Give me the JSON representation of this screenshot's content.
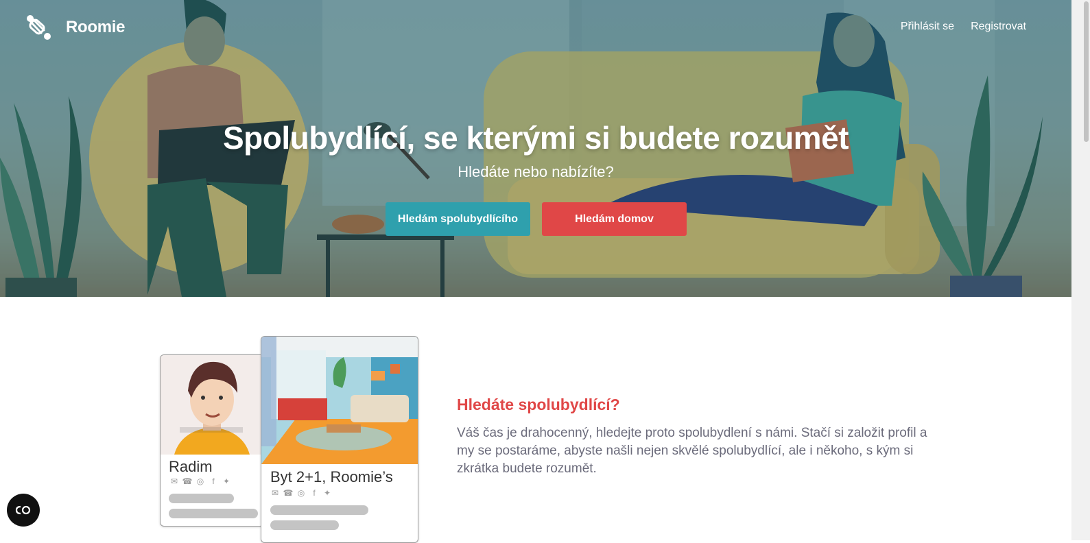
{
  "app": {
    "name": "Roomie"
  },
  "nav": {
    "login": "Přihlásit se",
    "register": "Registrovat"
  },
  "hero": {
    "title": "Spolubydlící, se kterými si budete rozumět",
    "subtitle": "Hledáte nebo nabízíte?",
    "btn_roommate": "Hledám spolubydlícího",
    "btn_home": "Hledám domov"
  },
  "cards": {
    "person_name": "Radim",
    "flat_name": "Byt 2+1, Roomie’s"
  },
  "info": {
    "title": "Hledáte spolubydlící?",
    "text": "Váš čas je drahocenný, hledejte proto spolubydlení s námi. Stačí si založit profil a my se postaráme, abyste našli nejen skvělé spolubydlící, ale i někoho, s kým si zkrátka budete rozumět."
  },
  "colors": {
    "teal": "#2fa0ad",
    "red": "#e04747",
    "text_grey": "#6b6b7b"
  },
  "icons": [
    "logo-icon",
    "mail-icon",
    "phone-icon",
    "instagram-icon",
    "facebook-icon",
    "twitter-icon",
    "cookie-settings-icon"
  ]
}
